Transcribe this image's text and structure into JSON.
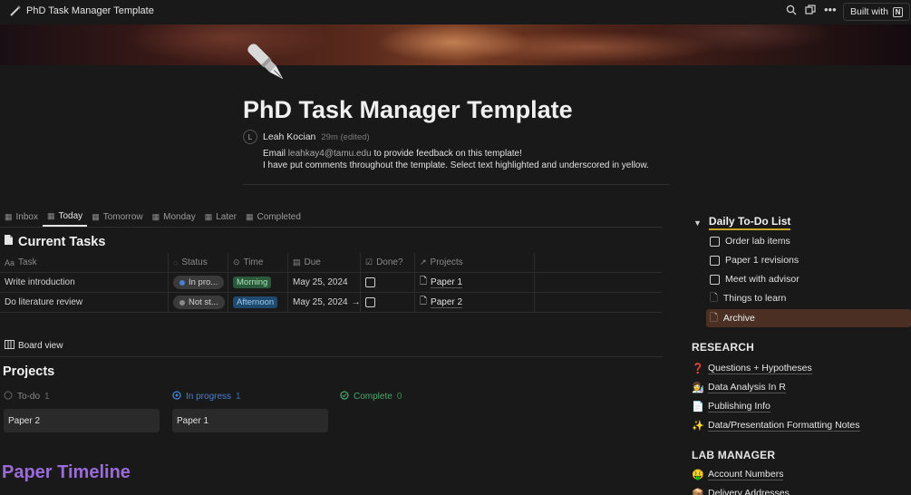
{
  "topbar": {
    "title": "PhD Task Manager Template",
    "built_with": "Built with"
  },
  "page": {
    "title": "PhD Task Manager Template",
    "author_initial": "L",
    "author": "Leah Kocian",
    "edited": "29m (edited)",
    "desc_prefix": "Email ",
    "email": "leahkay4@tamu.edu",
    "desc_suffix": " to provide feedback on this template!",
    "desc_line2": "I have put comments throughout the template. Select text highlighted and underscored in yellow."
  },
  "tabs": [
    "Inbox",
    "Today",
    "Tomorrow",
    "Monday",
    "Later",
    "Completed"
  ],
  "active_tab": "Today",
  "current_tasks": {
    "title": "Current Tasks",
    "columns": {
      "task": "Task",
      "task_prefix": "Aa",
      "status": "Status",
      "time": "Time",
      "due": "Due",
      "done": "Done?",
      "projects": "Projects"
    },
    "rows": [
      {
        "task": "Write introduction",
        "status": "In pro...",
        "status_color": "#4a7fd6",
        "time": "Morning",
        "time_bg": "#2b5a3a",
        "time_fg": "#a8e0b8",
        "due": "May 25, 2024",
        "due_arrow": "",
        "project": "Paper 1"
      },
      {
        "task": "Do literature review",
        "status": "Not st...",
        "status_color": "#8a8a8a",
        "time": "Afternoon",
        "time_bg": "#1f4a6e",
        "time_fg": "#9ccbf0",
        "due": "May 25, 2024",
        "due_arrow": "→",
        "project": "Paper 2"
      }
    ]
  },
  "board_view": "Board view",
  "projects": {
    "title": "Projects",
    "columns": [
      {
        "label": "To-do",
        "count": "1",
        "color": "#8a8a8a",
        "card": "Paper 2"
      },
      {
        "label": "In progress",
        "count": "1",
        "color": "#4a7fd6",
        "card": "Paper 1"
      },
      {
        "label": "Complete",
        "count": "0",
        "color": "#4aa86a",
        "card": ""
      }
    ]
  },
  "timeline_title": "Paper Timeline",
  "sidebar": {
    "todo_title": "Daily To-Do List",
    "todo_items": [
      "Order lab items",
      "Paper 1 revisions",
      "Meet with advisor"
    ],
    "pages": [
      "Things to learn"
    ],
    "archive": "Archive",
    "research_title": "RESEARCH",
    "research": [
      {
        "icon": "❓",
        "label": "Questions + Hypotheses"
      },
      {
        "icon": "👩‍🔬",
        "label": "Data Analysis In R"
      },
      {
        "icon": "📄",
        "label": "Publishing Info"
      },
      {
        "icon": "✨",
        "label": "Data/Presentation Formatting Notes"
      }
    ],
    "lab_title": "LAB MANAGER",
    "lab": [
      {
        "icon": "🤑",
        "label": "Account Numbers"
      },
      {
        "icon": "📦",
        "label": "Delivery Addresses"
      }
    ]
  }
}
